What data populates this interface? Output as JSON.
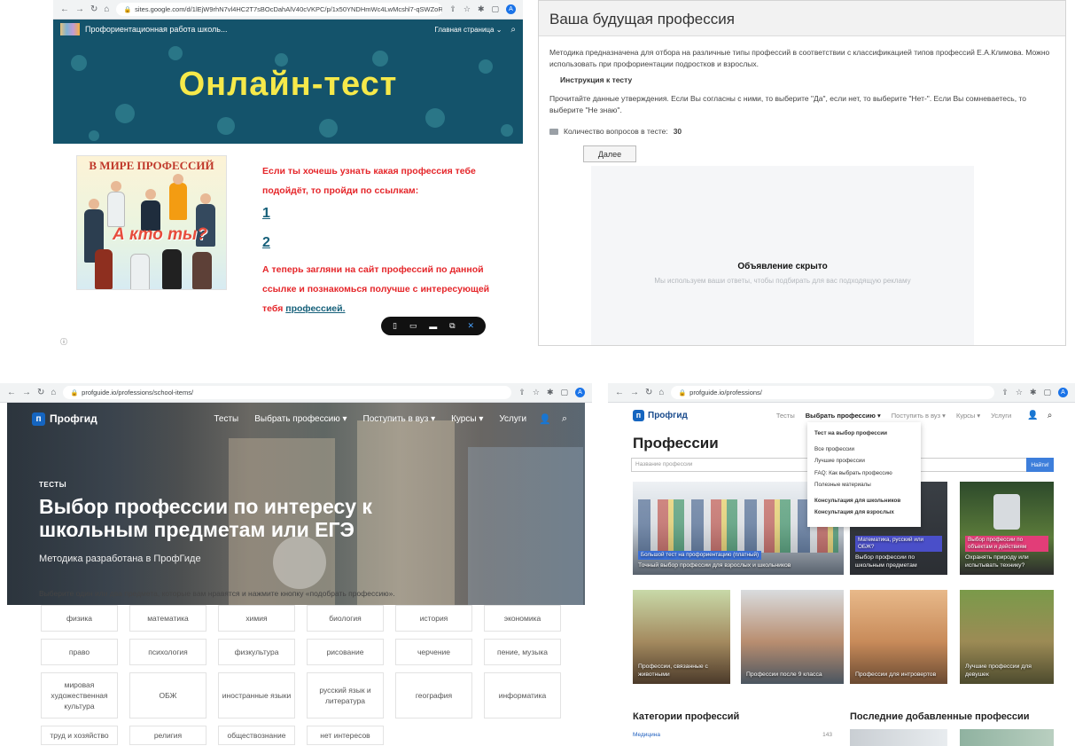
{
  "panel1": {
    "browser": {
      "url": "sites.google.com/d/1lEjW9rhN7vl4HC2T7sBOcDahAlV40cVKPC/p/1x50YNDHmWc4LwMcshl7-qSWZoR9l-RH/edit"
    },
    "site_title": "Профориентационная работа школь...",
    "nav_label": "Главная страница ⌄",
    "hero_title": "Онлайн-тест",
    "poster_title": "В МИРЕ ПРОФЕССИЙ",
    "poster_question": "А кто ты?",
    "text_intro": "Если ты хочешь узнать какая профессия тебе подойдёт, то пройди по ссылкам:",
    "link1": "1",
    "link2": "2",
    "text_outro": "А теперь загляни на сайт профессий по данной ссылке и познакомься получше с интересующей тебя",
    "link3": "профессией."
  },
  "panel2": {
    "title": "Ваша будущая профессия",
    "description": "Методика предназначена для отбора на различные типы профессий в соответствии с классификацией типов профессий Е.А.Климова. Можно использовать при профориентации подростков и взрослых.",
    "instr_heading": "Инструкция к тесту",
    "instructions": "Прочитайте данные утверждения. Если Вы согласны с ними, то выберите \"Да\", если нет, то выберите \"Нет-\". Если Вы сомневаетесь, то выберите \"Не знаю\".",
    "count_label": "Количество вопросов в тесте:",
    "count_value": "30",
    "next_button": "Далее",
    "ad_title": "Объявление скрыто",
    "ad_subtitle": "Мы используем ваши ответы, чтобы подбирать для вас подходящую рекламу"
  },
  "panel3": {
    "browser": {
      "url": "profguide.io/professions/school-items/"
    },
    "logo": "Профгид",
    "menu": [
      "Тесты",
      "Выбрать профессию ▾",
      "Поступить в вуз ▾",
      "Курсы ▾",
      "Услуги"
    ],
    "kicker": "ТЕСТЫ",
    "title": "Выбор профессии по интересу к школьным предметам или ЕГЭ",
    "subtitle": "Методика разработана в ПрофГиде",
    "instruction": "Выберите один или два предмета, которые вам нравятся и нажмите кнопку «подобрать профессию».",
    "subjects": [
      "физика",
      "математика",
      "химия",
      "биология",
      "история",
      "экономика",
      "право",
      "психология",
      "физкультура",
      "рисование",
      "черчение",
      "пение, музыка",
      "мировая художественная культура",
      "ОБЖ",
      "иностранные языки",
      "русский язык и литература",
      "география",
      "информатика",
      "труд и хозяйство",
      "религия",
      "обществознание",
      "нет интересов"
    ]
  },
  "panel4": {
    "browser": {
      "url": "profguide.io/professions/"
    },
    "logo": "Профгид",
    "menu": [
      "Тесты",
      "Выбрать профессию ▾",
      "Поступить в вуз ▾",
      "Курсы ▾",
      "Услуги"
    ],
    "heading": "Профессии",
    "search_placeholder": "Название профессии",
    "search_button": "Найти!",
    "dropdown": [
      "Тест на выбор профессии",
      "Все профессии",
      "Лучшие профессии",
      "FAQ: Как выбрать профессию",
      "Полезные материалы",
      "Консультация для школьников",
      "Консультация для взрослых"
    ],
    "cards": [
      {
        "tag": "Большой тест на профориентацию (платный)",
        "caption": "Точный выбор профессии для взрослых и школьников",
        "tag_color": "#3b6fd6"
      },
      {
        "tag": "Математика, русский или ОБЖ?",
        "caption": "Выбор профессии по школьным предметам",
        "tag_color": "#4a4fc9"
      },
      {
        "tag": "Выбор профессии по объектам и действиям",
        "caption": "Охранять природу или испытывать технику?",
        "tag_color": "#e23d78"
      },
      {
        "caption": "Профессии, связанные с животными"
      },
      {
        "caption": "Профессии после 9 класса"
      },
      {
        "caption": "Профессии для интровертов"
      },
      {
        "caption": "Лучшие профессии для девушек"
      }
    ],
    "categories_heading": "Категории профессий",
    "latest_heading": "Последние добавленные профессии",
    "category_first": "Медицина",
    "category_first_count": "143"
  }
}
